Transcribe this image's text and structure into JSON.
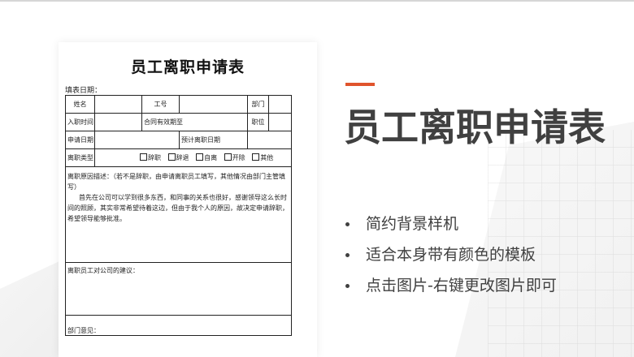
{
  "form": {
    "title": "员工离职申请表",
    "fill_date_label": "填表日期：",
    "row1": {
      "name": "姓名",
      "job_no": "工号",
      "dept": "部门"
    },
    "row2": {
      "entry_date": "入职时间",
      "contract_end": "合同有效期至",
      "position": "职位"
    },
    "row3": {
      "apply_date": "申请日期",
      "expected_leave": "预计离职日期"
    },
    "row4": {
      "type_label": "离职类型",
      "options": [
        "辞职",
        "辞退",
        "自离",
        "开除",
        "其他"
      ]
    },
    "reason": {
      "heading": "离职原因描述：（若不是辞职，由申请离职员工填写，其他情况由部门主管填写）",
      "body": "首先在公司可以学到很多东西，和同事的关系也很好，感谢领导这么长时间的照顾，其实非常希望待着这边，但由于我个人的原因，故决定申请辞职，希望领导能够批准。"
    },
    "advice_label": "离职员工对公司的建议：",
    "last_label": "部门意见："
  },
  "panel": {
    "title": "员工离职申请表",
    "bullets": [
      "简约背景样机",
      "适合本身带有颜色的模板",
      "点击图片-右键更改图片即可"
    ]
  },
  "colors": {
    "accent": "#e0542c",
    "heading_text": "#404040"
  }
}
